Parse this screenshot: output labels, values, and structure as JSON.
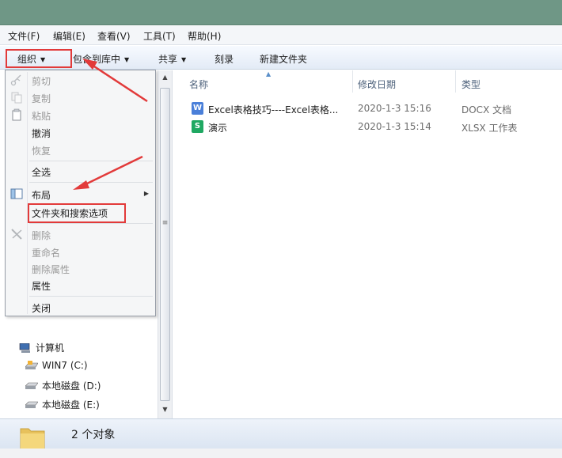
{
  "menubar": {
    "items": [
      "文件(F)",
      "编辑(E)",
      "查看(V)",
      "工具(T)",
      "帮助(H)"
    ]
  },
  "toolbar": {
    "organize": "组织",
    "include_in_library": "包含到库中",
    "share": "共享",
    "burn": "刻录",
    "new_folder": "新建文件夹"
  },
  "organize_menu": {
    "items": [
      {
        "label": "剪切",
        "enabled": false,
        "icon": "scissors-icon"
      },
      {
        "label": "复制",
        "enabled": false,
        "icon": "copy-icon"
      },
      {
        "label": "粘贴",
        "enabled": false,
        "icon": "paste-icon"
      },
      {
        "label": "撤消",
        "enabled": true
      },
      {
        "label": "恢复",
        "enabled": false
      },
      {
        "label": "全选",
        "enabled": true
      },
      {
        "label": "布局",
        "enabled": true,
        "icon": "layout-icon",
        "has_submenu": true
      },
      {
        "label": "文件夹和搜索选项",
        "enabled": true,
        "highlighted": true
      },
      {
        "label": "删除",
        "enabled": false,
        "icon": "delete-x-icon"
      },
      {
        "label": "重命名",
        "enabled": false
      },
      {
        "label": "删除属性",
        "enabled": false
      },
      {
        "label": "属性",
        "enabled": true
      },
      {
        "label": "关闭",
        "enabled": true
      }
    ]
  },
  "nav_tree": {
    "computer": "计算机",
    "drives": [
      "WIN7 (C:)",
      "本地磁盘 (D:)",
      "本地磁盘 (E:)"
    ]
  },
  "file_list": {
    "columns": [
      "名称",
      "修改日期",
      "类型"
    ],
    "rows": [
      {
        "name": "Excel表格技巧----Excel表格...",
        "date": "2020-1-3 15:16",
        "type": "DOCX 文档",
        "icon": "word-doc-icon",
        "icon_letter": "W",
        "icon_color": "#4a7fd9"
      },
      {
        "name": "演示",
        "date": "2020-1-3 15:14",
        "type": "XLSX 工作表",
        "icon": "spreadsheet-icon",
        "icon_letter": "S",
        "icon_color": "#1fa862"
      }
    ]
  },
  "status": {
    "text": "2 个对象"
  },
  "colors": {
    "titlebar": "#6f9786",
    "annotation_red": "#e23a3a"
  }
}
